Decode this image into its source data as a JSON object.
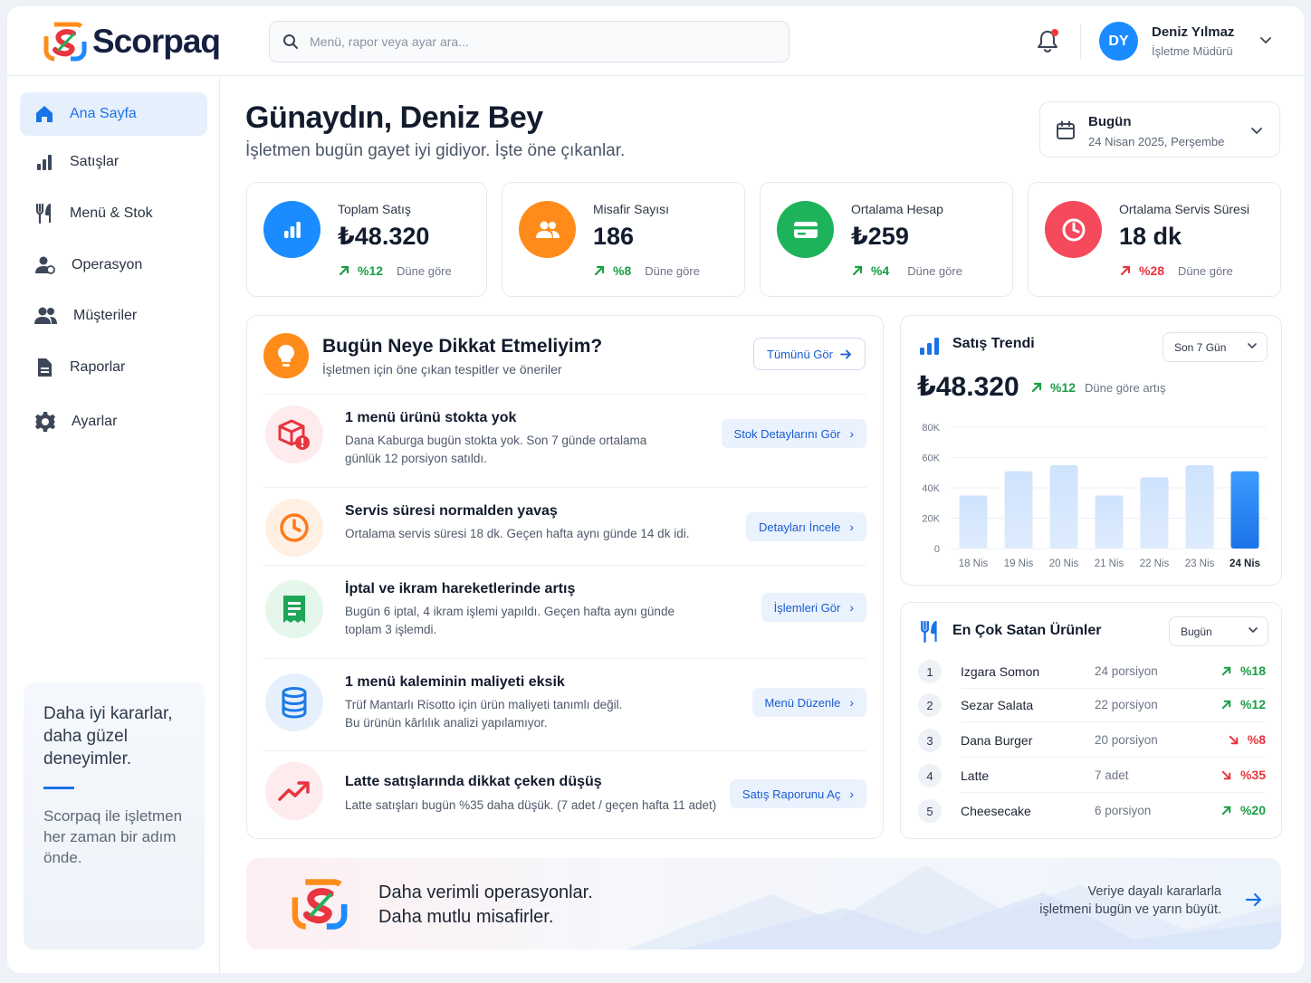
{
  "app": {
    "name": "Scorpaq"
  },
  "search": {
    "placeholder": "Menü, rapor veya ayar ara..."
  },
  "user": {
    "initials": "DY",
    "name": "Deniz Yılmaz",
    "role": "İşletme Müdürü"
  },
  "sidebar": {
    "items": [
      {
        "label": "Ana Sayfa",
        "icon": "home-icon",
        "active": true
      },
      {
        "label": "Satışlar",
        "icon": "bar-chart-icon"
      },
      {
        "label": "Menü & Stok",
        "icon": "fork-knife-icon"
      },
      {
        "label": "Operasyon",
        "icon": "person-icon"
      },
      {
        "label": "Müşteriler",
        "icon": "users-icon"
      },
      {
        "label": "Raporlar",
        "icon": "document-icon"
      },
      {
        "label": "Ayarlar",
        "icon": "gear-icon"
      }
    ],
    "promo": {
      "title": "Daha iyi kararlar, daha güzel deneyimler.",
      "subtitle": "Scorpaq ile işletmen her zaman bir adım önde."
    }
  },
  "header": {
    "greeting": "Günaydın, Deniz Bey",
    "subtitle": "İşletmen bugün gayet iyi gidiyor. İşte öne çıkanlar.",
    "date_label": "Bugün",
    "date_value": "24 Nisan 2025, Perşembe"
  },
  "kpis": [
    {
      "label": "Toplam Satış",
      "value": "₺48.320",
      "delta": "%12",
      "direction": "up",
      "compare": "Düne göre",
      "color": "#1a8cff",
      "icon": "bar-chart-icon"
    },
    {
      "label": "Misafir Sayısı",
      "value": "186",
      "delta": "%8",
      "direction": "up",
      "compare": "Düne göre",
      "color": "#ff8c1a",
      "icon": "users-icon"
    },
    {
      "label": "Ortalama Hesap",
      "value": "₺259",
      "delta": "%4",
      "direction": "up",
      "compare": "Düne göre",
      "color": "#1db35a",
      "icon": "card-icon"
    },
    {
      "label": "Ortalama Servis Süresi",
      "value": "18 dk",
      "delta": "%28",
      "direction": "up-bad",
      "compare": "Düne göre",
      "color": "#f5495c",
      "icon": "clock-icon"
    }
  ],
  "attention": {
    "title": "Bugün Neye Dikkat Etmeliyim?",
    "subtitle": "İşletmen için öne çıkan tespitler ve öneriler",
    "view_all": "Tümünü Gör",
    "items": [
      {
        "title": "1 menü ürünü stokta yok",
        "desc1": "Dana Kaburga bugün stokta yok. Son 7 günde ortalama",
        "desc2": "günlük 12 porsiyon satıldı.",
        "action": "Stok Detaylarını Gör",
        "icon": "box-alert-icon",
        "color": "#e8353f"
      },
      {
        "title": "Servis süresi normalden yavaş",
        "desc1": "Ortalama servis süresi 18 dk. Geçen hafta aynı günde 14 dk idi.",
        "desc2": "",
        "action": "Detayları İncele",
        "icon": "clock-icon",
        "color": "#ff7a1a"
      },
      {
        "title": "İptal ve ikram hareketlerinde artış",
        "desc1": "Bugün 6 iptal, 4 ikram işlemi yapıldı. Geçen hafta aynı günde",
        "desc2": "toplam 3 işlemdi.",
        "action": "İşlemleri Gör",
        "icon": "receipt-icon",
        "color": "#1da558"
      },
      {
        "title": "1 menü kaleminin maliyeti eksik",
        "desc1": "Trüf Mantarlı Risotto için ürün maliyeti tanımlı değil.",
        "desc2": "Bu ürünün kârlılık analizi yapılamıyor.",
        "action": "Menü Düzenle",
        "icon": "database-icon",
        "color": "#1a7ae8"
      },
      {
        "title": "Latte satışlarında dikkat çeken düşüş",
        "desc1": "Latte satışları bugün %35 daha düşük. (7 adet / geçen hafta 11 adet)",
        "desc2": "",
        "action": "Satış Raporunu Aç",
        "icon": "trend-icon",
        "color": "#e8353f"
      }
    ]
  },
  "trend": {
    "title": "Satış Trendi",
    "period": "Son 7 Gün",
    "total": "₺48.320",
    "delta": "%12",
    "compare": "Düne göre artış"
  },
  "chart_data": {
    "type": "bar",
    "categories": [
      "18 Nis",
      "19 Nis",
      "20 Nis",
      "21 Nis",
      "22 Nis",
      "23 Nis",
      "24 Nis"
    ],
    "values": [
      35000,
      51000,
      55000,
      35000,
      47000,
      55000,
      51000
    ],
    "ylim": [
      0,
      80000
    ],
    "yticks": [
      "0",
      "20K",
      "40K",
      "60K",
      "80K"
    ],
    "highlight": "24 Nis",
    "grid": true
  },
  "top_products": {
    "title": "En Çok Satan Ürünler",
    "period": "Bugün",
    "items": [
      {
        "rank": "1",
        "name": "Izgara Somon",
        "qty": "24 porsiyon",
        "delta": "%18",
        "direction": "up"
      },
      {
        "rank": "2",
        "name": "Sezar Salata",
        "qty": "22 porsiyon",
        "delta": "%12",
        "direction": "up"
      },
      {
        "rank": "3",
        "name": "Dana Burger",
        "qty": "20 porsiyon",
        "delta": "%8",
        "direction": "down"
      },
      {
        "rank": "4",
        "name": "Latte",
        "qty": "7 adet",
        "delta": "%35",
        "direction": "down"
      },
      {
        "rank": "5",
        "name": "Cheesecake",
        "qty": "6 porsiyon",
        "delta": "%20",
        "direction": "up"
      }
    ]
  },
  "banner": {
    "line1": "Daha verimli operasyonlar.",
    "line2": "Daha mutlu misafirler.",
    "right1": "Veriye dayalı kararlarla",
    "right2": "işletmeni bugün ve yarın büyüt."
  },
  "colors": {
    "accent": "#1a73e8",
    "up": "#1a9e45",
    "down": "#e8353f"
  }
}
